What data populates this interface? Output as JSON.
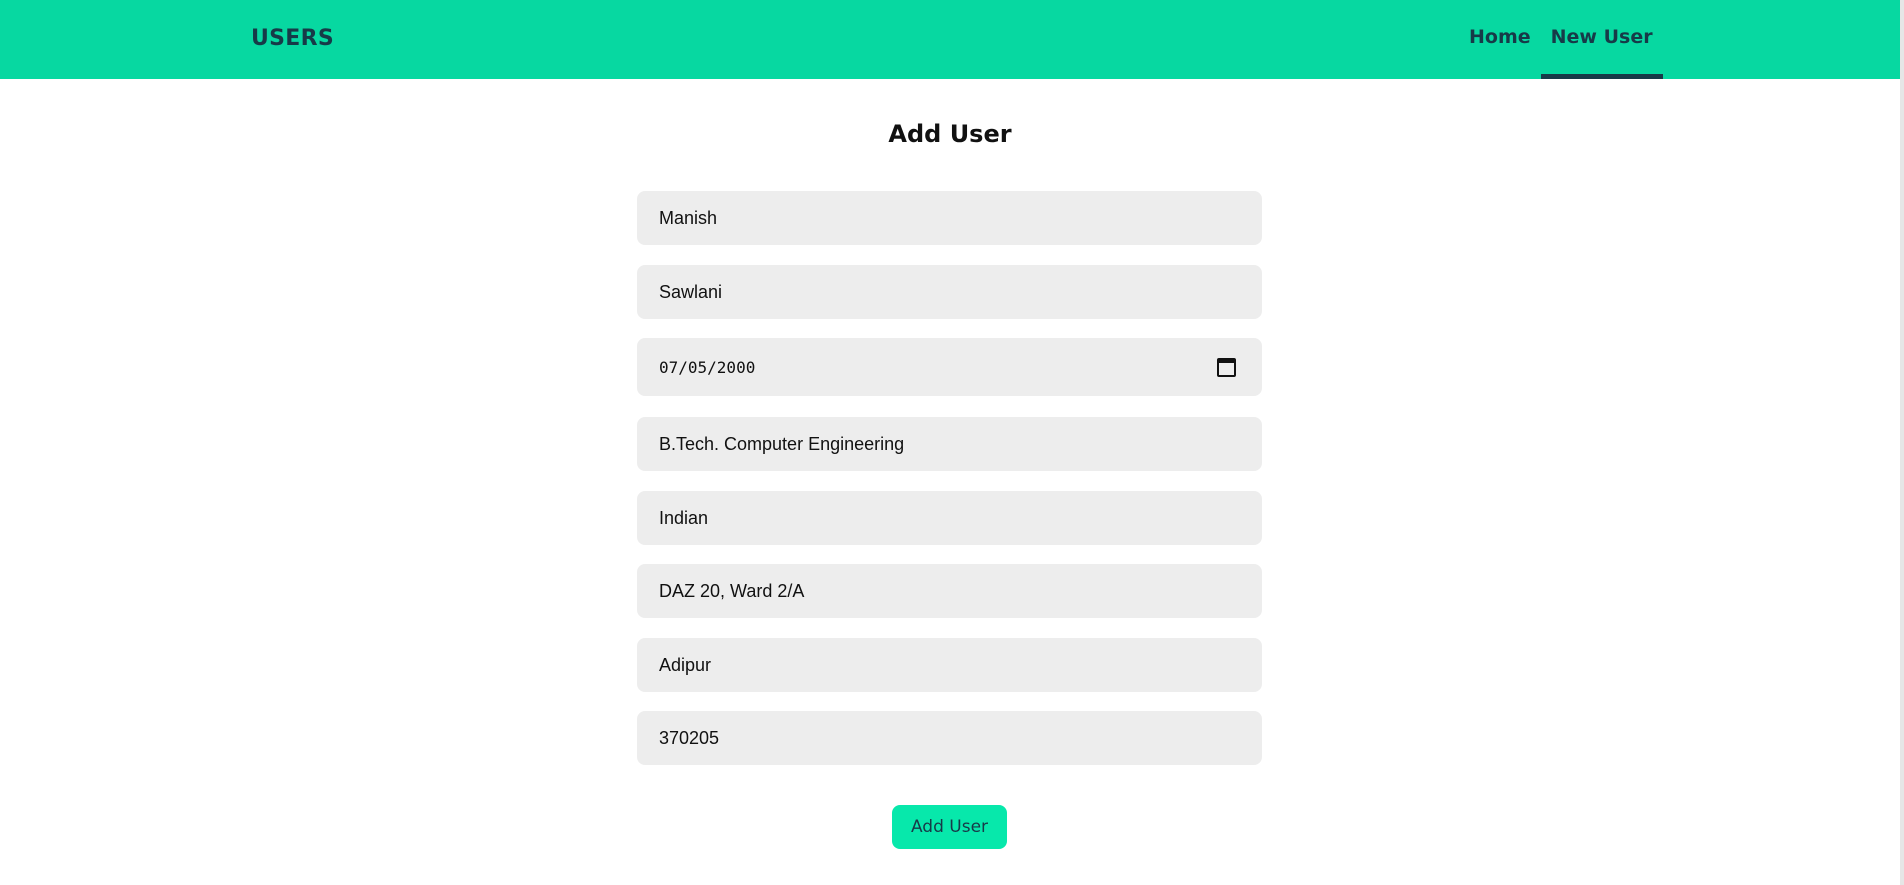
{
  "navbar": {
    "brand": "USERS",
    "links": [
      {
        "label": "Home",
        "active": false
      },
      {
        "label": "New User",
        "active": true
      }
    ]
  },
  "form": {
    "title": "Add User",
    "fields": {
      "first_name": "Manish",
      "last_name": "Sawlani",
      "dob": "07/05/2000",
      "qualification": "B.Tech. Computer Engineering",
      "nationality": "Indian",
      "address": "DAZ 20, Ward 2/A",
      "city": "Adipur",
      "pincode": "370205"
    },
    "submit_label": "Add User"
  },
  "colors": {
    "navbar": "#07d8a1",
    "brand_text": "#173a48",
    "field_bg": "#ededed",
    "button": "#07e8ab"
  },
  "icons": {
    "date_picker": "calendar-icon"
  }
}
